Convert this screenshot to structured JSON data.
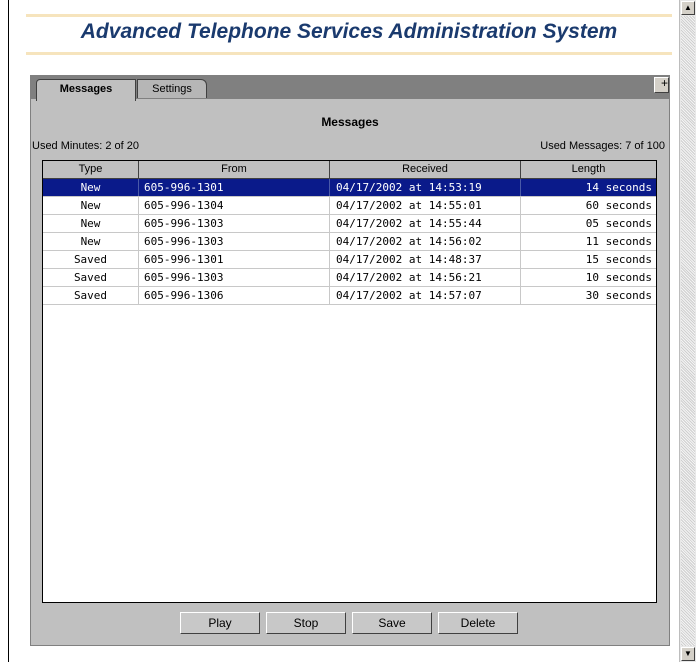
{
  "app": {
    "title": "Advanced Telephone Services Administration System"
  },
  "tabs": [
    {
      "label": "Messages",
      "active": true
    },
    {
      "label": "Settings",
      "active": false
    }
  ],
  "panel": {
    "title": "Messages",
    "used_minutes": "Used Minutes: 2 of 20",
    "used_messages": "Used Messages: 7 of 100"
  },
  "table": {
    "columns": [
      "Type",
      "From",
      "Received",
      "Length"
    ],
    "selected_index": 0,
    "rows": [
      {
        "type": "New",
        "from": "605-996-1301",
        "received": "04/17/2002 at 14:53:19",
        "length": "14 seconds"
      },
      {
        "type": "New",
        "from": "605-996-1304",
        "received": "04/17/2002 at 14:55:01",
        "length": "60 seconds"
      },
      {
        "type": "New",
        "from": "605-996-1303",
        "received": "04/17/2002 at 14:55:44",
        "length": "05 seconds"
      },
      {
        "type": "New",
        "from": "605-996-1303",
        "received": "04/17/2002 at 14:56:02",
        "length": "11 seconds"
      },
      {
        "type": "Saved",
        "from": "605-996-1301",
        "received": "04/17/2002 at 14:48:37",
        "length": "15 seconds"
      },
      {
        "type": "Saved",
        "from": "605-996-1303",
        "received": "04/17/2002 at 14:56:21",
        "length": "10 seconds"
      },
      {
        "type": "Saved",
        "from": "605-996-1306",
        "received": "04/17/2002 at 14:57:07",
        "length": "30 seconds"
      }
    ]
  },
  "buttons": {
    "play": "Play",
    "stop": "Stop",
    "save": "Save",
    "delete": "Delete"
  },
  "icons": {
    "corner": "maximize-icon",
    "scroll_up": "scroll-up-arrow-icon",
    "scroll_down": "scroll-down-arrow-icon"
  },
  "colors": {
    "title_text": "#1a3a6e",
    "title_rule": "#f6e4bd",
    "selection": "#0a1a8a",
    "panel_bg": "#c0c0c0"
  }
}
